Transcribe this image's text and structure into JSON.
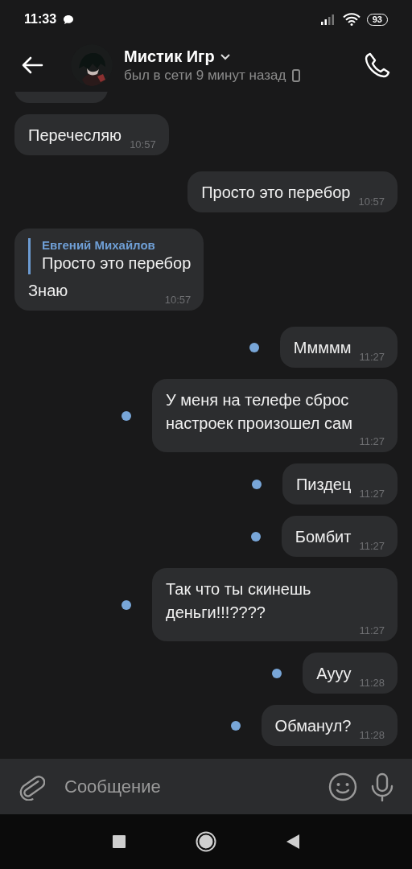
{
  "status_bar": {
    "time": "11:33",
    "battery": "93"
  },
  "header": {
    "name": "Мистик Игр",
    "status": "был в сети 9 минут назад"
  },
  "messages": [
    {
      "kind": "incoming",
      "text": "Перечесляю",
      "time": "10:57",
      "unread": false
    },
    {
      "kind": "outgoing",
      "text": "Просто это перебор",
      "time": "10:57",
      "unread": false
    },
    {
      "kind": "incoming",
      "reply": {
        "author": "Евгений Михайлов",
        "text": "Просто это перебор"
      },
      "text": "Знаю",
      "time": "10:57",
      "unread": false
    },
    {
      "kind": "outgoing",
      "text": "Ммммм",
      "time": "11:27",
      "unread": true
    },
    {
      "kind": "outgoing",
      "text": "У меня на телефе сброс настроек произошел сам",
      "time": "11:27",
      "unread": true
    },
    {
      "kind": "outgoing",
      "text": "Пиздец",
      "time": "11:27",
      "unread": true
    },
    {
      "kind": "outgoing",
      "text": "Бомбит",
      "time": "11:27",
      "unread": true
    },
    {
      "kind": "outgoing",
      "text": "Так что ты скинешь деньги!!!????",
      "time": "11:27",
      "unread": true
    },
    {
      "kind": "outgoing",
      "text": "Аууу",
      "time": "11:28",
      "unread": true
    },
    {
      "kind": "outgoing",
      "text": "Обманул?",
      "time": "11:28",
      "unread": true
    }
  ],
  "composer": {
    "placeholder": "Сообщение"
  }
}
